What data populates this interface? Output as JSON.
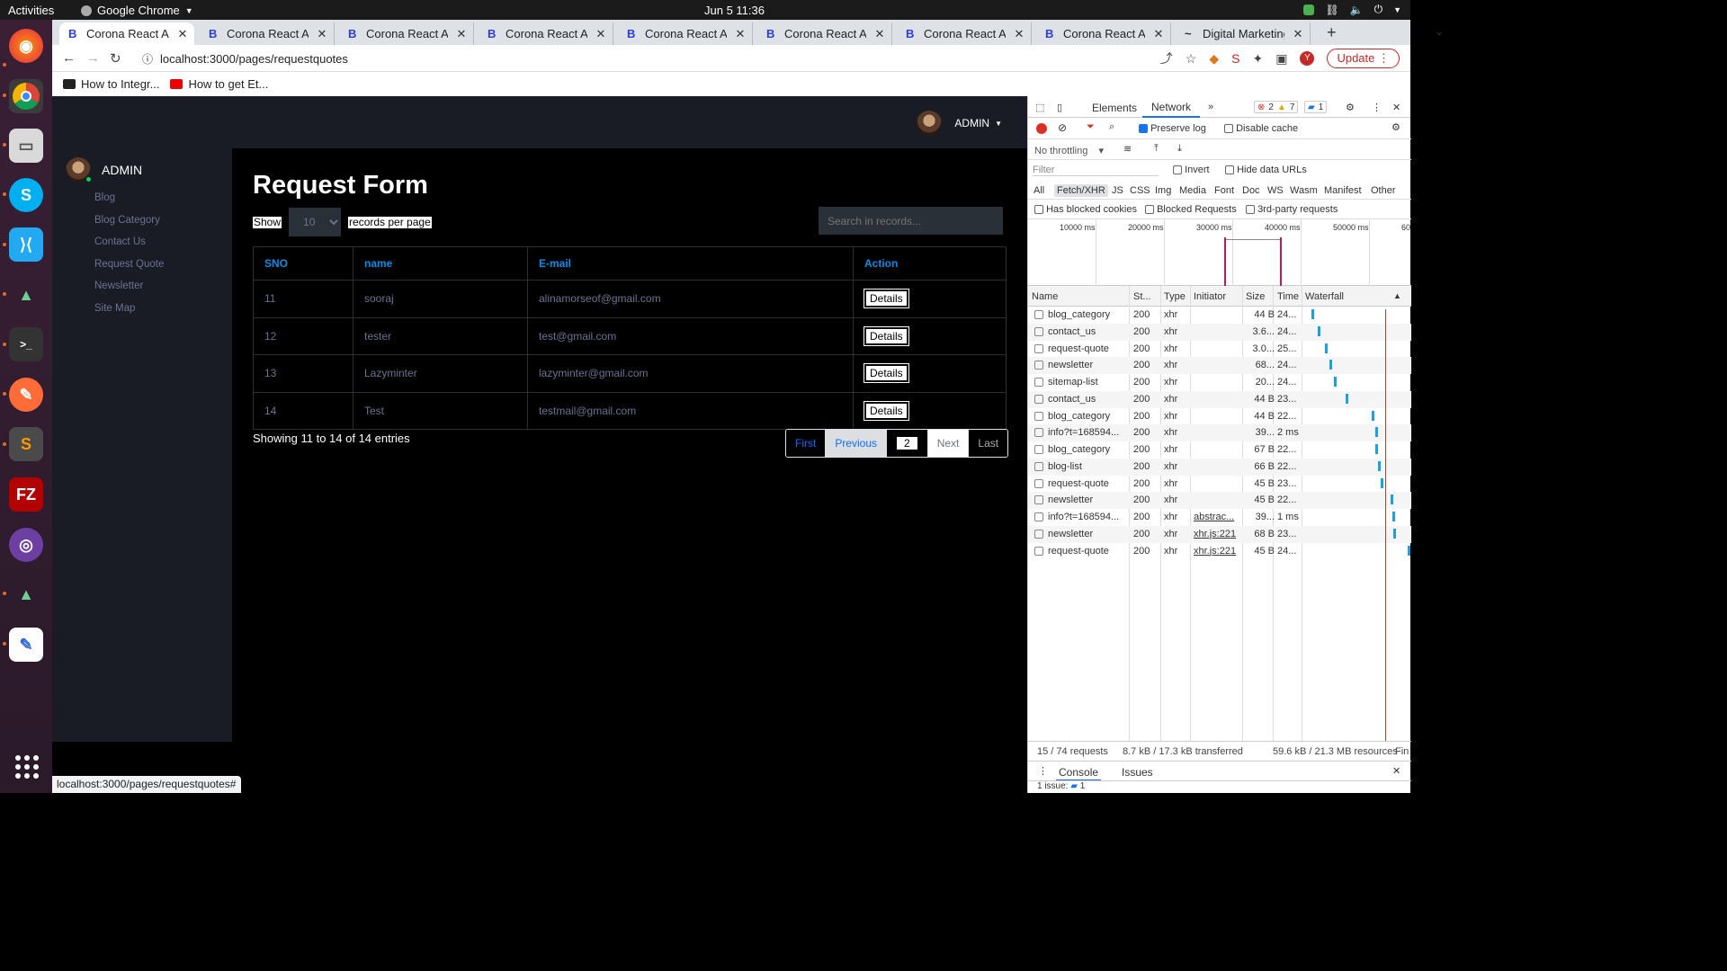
{
  "system": {
    "activities": "Activities",
    "app_name": "Google Chrome",
    "clock": "Jun 5  11:36"
  },
  "browser": {
    "tabs": [
      {
        "title": "Corona React Adm",
        "active": true
      },
      {
        "title": "Corona React Adm"
      },
      {
        "title": "Corona React Adm"
      },
      {
        "title": "Corona React Adm"
      },
      {
        "title": "Corona React Adm"
      },
      {
        "title": "Corona React Adm"
      },
      {
        "title": "Corona React Adm"
      },
      {
        "title": "Corona React Adm"
      },
      {
        "title": "Digital Marketing"
      }
    ],
    "url": "localhost:3000/pages/requestquotes",
    "update_label": "Update",
    "profile_initial": "Y",
    "bookmarks": [
      "How to Integr...",
      "How to get Et..."
    ],
    "status_url": "localhost:3000/pages/requestquotes#"
  },
  "app": {
    "navbar_user": "ADMIN",
    "sidebar_user": "ADMIN",
    "sidebar_items": [
      "Blog",
      "Blog Category",
      "Contact Us",
      "Request Quote",
      "Newsletter",
      "Site Map"
    ],
    "page_title": "Request Form",
    "show_label": "Show",
    "per_page_value": "10",
    "per_page_suffix": "records per page",
    "search_placeholder": "Search in records...",
    "table": {
      "headers": [
        "SNO",
        "name",
        "E-mail",
        "Action"
      ],
      "rows": [
        {
          "sno": "11",
          "name": "sooraj",
          "email": "alinamorseof@gmail.com",
          "action": "Details"
        },
        {
          "sno": "12",
          "name": "tester",
          "email": "test@gmail.com",
          "action": "Details"
        },
        {
          "sno": "13",
          "name": "Lazyminter",
          "email": "lazyminter@gmail.com",
          "action": "Details"
        },
        {
          "sno": "14",
          "name": "Test",
          "email": "testmail@gmail.com",
          "action": "Details"
        }
      ]
    },
    "entries_info": "Showing 11 to 14 of 14 entries",
    "pager": {
      "first": "First",
      "previous": "Previous",
      "current": "2",
      "next": "Next",
      "last": "Last"
    }
  },
  "devtools": {
    "tabs": {
      "elements": "Elements",
      "network": "Network"
    },
    "errors": "2",
    "warnings": "7",
    "messages": "1",
    "preserve_log": "Preserve log",
    "disable_cache": "Disable cache",
    "throttling": "No throttling",
    "filter_placeholder": "Filter",
    "invert": "Invert",
    "hide_data_urls": "Hide data URLs",
    "type_filters": [
      "All",
      "Fetch/XHR",
      "JS",
      "CSS",
      "Img",
      "Media",
      "Font",
      "Doc",
      "WS",
      "Wasm",
      "Manifest",
      "Other"
    ],
    "has_blocked_cookies": "Has blocked cookies",
    "blocked_requests": "Blocked Requests",
    "third_party": "3rd-party requests",
    "timeline_ticks": [
      "10000 ms",
      "20000 ms",
      "30000 ms",
      "40000 ms",
      "50000 ms",
      "60"
    ],
    "columns": [
      "Name",
      "St...",
      "Type",
      "Initiator",
      "Size",
      "Time",
      "Waterfall"
    ],
    "requests": [
      {
        "name": "blog_category",
        "status": "200",
        "type": "xhr",
        "initiator": "",
        "size": "44 B",
        "time": "24..."
      },
      {
        "name": "contact_us",
        "status": "200",
        "type": "xhr",
        "initiator": "",
        "size": "3.6...",
        "time": "24..."
      },
      {
        "name": "request-quote",
        "status": "200",
        "type": "xhr",
        "initiator": "",
        "size": "3.0...",
        "time": "25..."
      },
      {
        "name": "newsletter",
        "status": "200",
        "type": "xhr",
        "initiator": "",
        "size": "68...",
        "time": "24..."
      },
      {
        "name": "sitemap-list",
        "status": "200",
        "type": "xhr",
        "initiator": "",
        "size": "20...",
        "time": "24..."
      },
      {
        "name": "contact_us",
        "status": "200",
        "type": "xhr",
        "initiator": "",
        "size": "44 B",
        "time": "23..."
      },
      {
        "name": "blog_category",
        "status": "200",
        "type": "xhr",
        "initiator": "",
        "size": "44 B",
        "time": "22..."
      },
      {
        "name": "info?t=168594...",
        "status": "200",
        "type": "xhr",
        "initiator": "",
        "size": "39...",
        "time": "2 ms"
      },
      {
        "name": "blog_category",
        "status": "200",
        "type": "xhr",
        "initiator": "",
        "size": "67 B",
        "time": "22..."
      },
      {
        "name": "blog-list",
        "status": "200",
        "type": "xhr",
        "initiator": "",
        "size": "66 B",
        "time": "22..."
      },
      {
        "name": "request-quote",
        "status": "200",
        "type": "xhr",
        "initiator": "",
        "size": "45 B",
        "time": "23..."
      },
      {
        "name": "newsletter",
        "status": "200",
        "type": "xhr",
        "initiator": "",
        "size": "45 B",
        "time": "22..."
      },
      {
        "name": "info?t=168594...",
        "status": "200",
        "type": "xhr",
        "initiator": "abstrac...",
        "size": "39...",
        "time": "1 ms"
      },
      {
        "name": "newsletter",
        "status": "200",
        "type": "xhr",
        "initiator": "xhr.js:221",
        "size": "68 B",
        "time": "23..."
      },
      {
        "name": "request-quote",
        "status": "200",
        "type": "xhr",
        "initiator": "xhr.js:221",
        "size": "45 B",
        "time": "24..."
      }
    ],
    "summary": {
      "requests": "15 / 74 requests",
      "transferred": "8.7 kB / 17.3 kB transferred",
      "resources": "59.6 kB / 21.3 MB resources",
      "finish": "Fin"
    },
    "drawer": {
      "console": "Console",
      "issues": "Issues"
    },
    "issue_line": "1 issue:",
    "issue_count": "1"
  }
}
